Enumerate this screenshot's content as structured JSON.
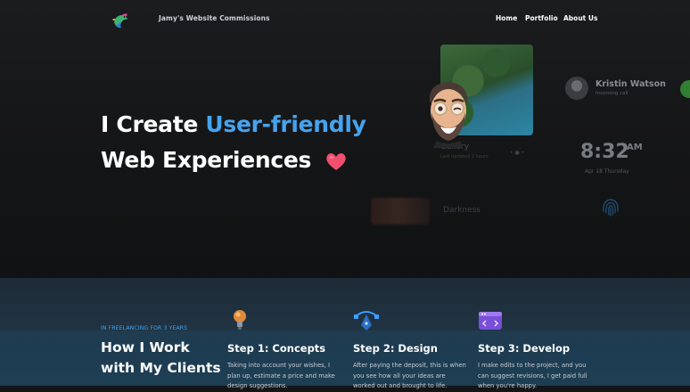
{
  "header": {
    "site_title": "Jamy's Website Commissions",
    "nav": {
      "home": "Home",
      "portfolio": "Portfolio",
      "about": "About Us"
    }
  },
  "hero": {
    "headline_part1": "I Create ",
    "headline_accent": "User-friendly",
    "headline_line2": "Web Experiences",
    "accent_color": "#46a3ee",
    "heart_icon": "heart-icon"
  },
  "phone_mock": {
    "gallery_label": "Gallery",
    "gallery_sub": "Last Updated 2 hours",
    "contact_name": "Kristin Watson",
    "contact_status": "Incoming call",
    "clock_time": "8:32",
    "clock_ampm": "AM",
    "clock_date": "Apr 18 Thursday",
    "dark_label": "Darkness"
  },
  "how_section": {
    "eyebrow": "IN FREELANCING FOR 3 YEARS",
    "title_line1": "How I Work",
    "title_line2": "with My Clients",
    "steps": [
      {
        "title": "Step 1: Concepts",
        "text": "Taking into account your wishes, I plan up, estimate a price and make design suggestions."
      },
      {
        "title": "Step 2: Design",
        "text": "After paying the deposit, this is when you see how all your ideas are worked out and brought to life."
      },
      {
        "title": "Step 3: Develop",
        "text": "I make edits to the project, and you can suggest revisions, I get paid full when you're happy."
      }
    ]
  }
}
